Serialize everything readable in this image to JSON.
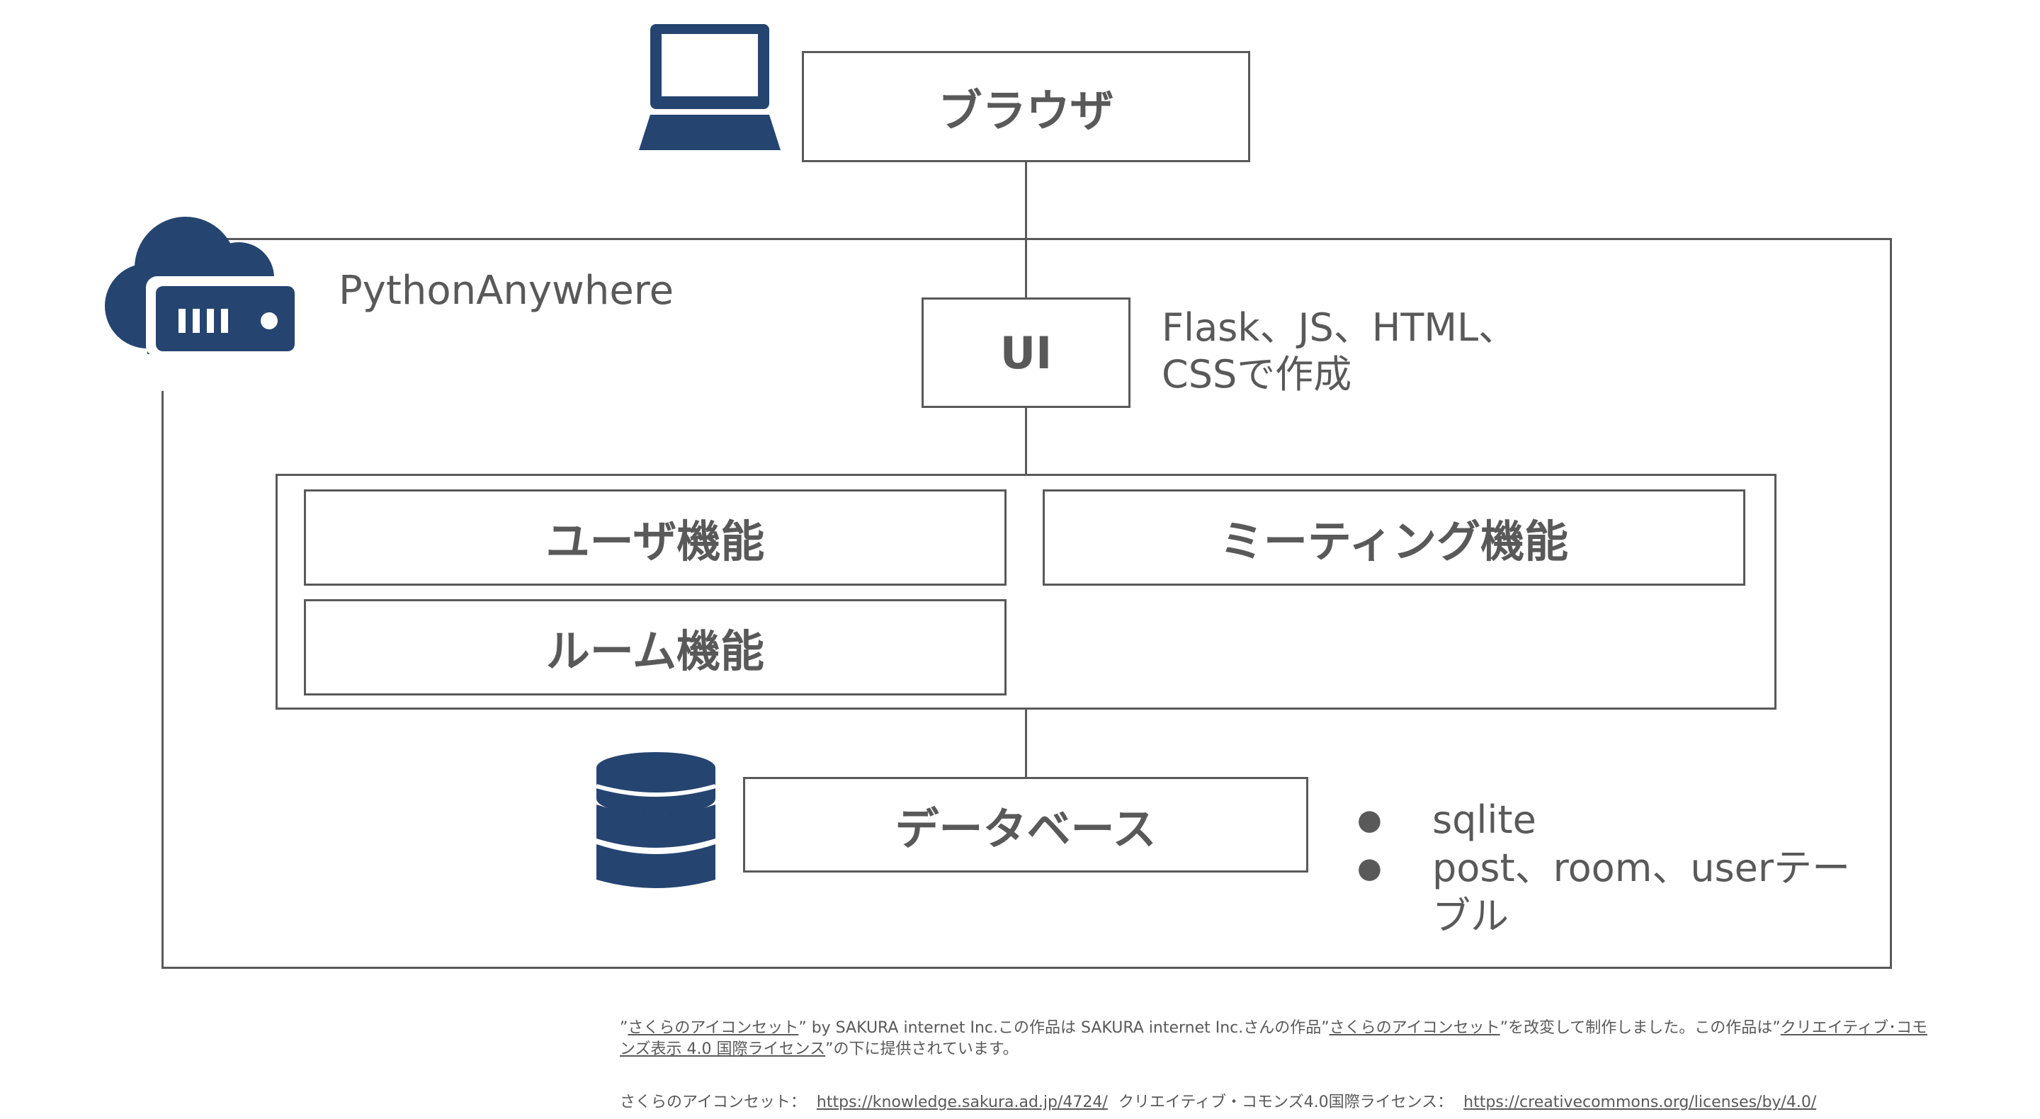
{
  "colors": {
    "icon": "#254470",
    "border": "#595959",
    "text": "#595959"
  },
  "icons": {
    "client": "laptop-icon",
    "host": "cloud-server-icon",
    "storage": "database-icon"
  },
  "browser": {
    "label": "ブラウザ"
  },
  "host": {
    "label": "PythonAnywhere"
  },
  "ui": {
    "label": "UI",
    "note_line1": "Flask、JS、HTML、",
    "note_line2": "CSSで作成"
  },
  "features": {
    "user": "ユーザ機能",
    "meeting": "ミーティング機能",
    "room": "ルーム機能"
  },
  "database": {
    "label": "データベース",
    "bullet_mark": "●",
    "items": [
      "sqlite",
      "post、room、userテー",
      "ブル"
    ]
  },
  "credits": {
    "q1": "”",
    "link1": "さくらのアイコンセット",
    "t1": "” by SAKURA internet Inc.この作品は SAKURA internet Inc.さんの作品”",
    "link2": "さくらのアイコンセット",
    "t2": "”を改変して制作しました。この作品は”",
    "link3a": "クリエイティブ･コモ",
    "link3b": "ンズ表示 4.0 国際ライセンス",
    "t3": "”の下に提供されています。",
    "label4": "さくらのアイコンセット：",
    "url1": "https://knowledge.sakura.ad.jp/4724/",
    "label5": "クリエイティブ・コモンズ4.0国際ライセンス：",
    "url2": "https://creativecommons.org/licenses/by/4.0/"
  }
}
